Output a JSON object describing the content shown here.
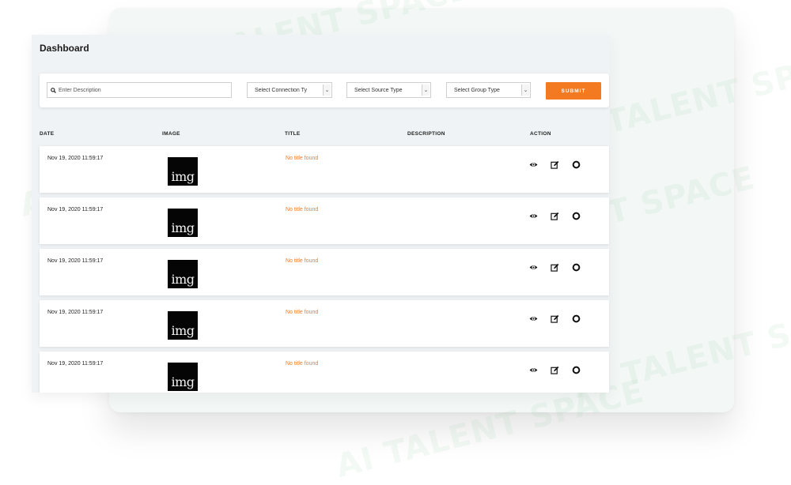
{
  "page": {
    "title": "Dashboard"
  },
  "watermark": {
    "text": "AI TALENT SPACE"
  },
  "filters": {
    "search_placeholder": "Enter Description",
    "connection_type": "Select Connection Ty",
    "source_type": "Select Source Type",
    "group_type": "Select Group Type",
    "submit_label": "SUBMIT"
  },
  "table": {
    "columns": [
      "DATE",
      "IMAGE",
      "TITLE",
      "DESCRIPTION",
      "ACTION"
    ],
    "rows": [
      {
        "date": "Nov 19, 2020 11:59:17",
        "image": "img",
        "title": "No title found",
        "description": ""
      },
      {
        "date": "Nov 19, 2020 11:59:17",
        "image": "img",
        "title": "No title found",
        "description": ""
      },
      {
        "date": "Nov 19, 2020 11:59:17",
        "image": "img",
        "title": "No title found",
        "description": ""
      },
      {
        "date": "Nov 19, 2020 11:59:17",
        "image": "img",
        "title": "No title found",
        "description": ""
      },
      {
        "date": "Nov 19, 2020 11:59:17",
        "image": "img",
        "title": "No title found",
        "description": ""
      }
    ],
    "actions": [
      "eye-icon",
      "edit-icon",
      "toggle-icon"
    ]
  },
  "colors": {
    "accent": "#f47a22",
    "panel_bg": "#f0f3f5",
    "thumbnail_bg": "#050505"
  }
}
